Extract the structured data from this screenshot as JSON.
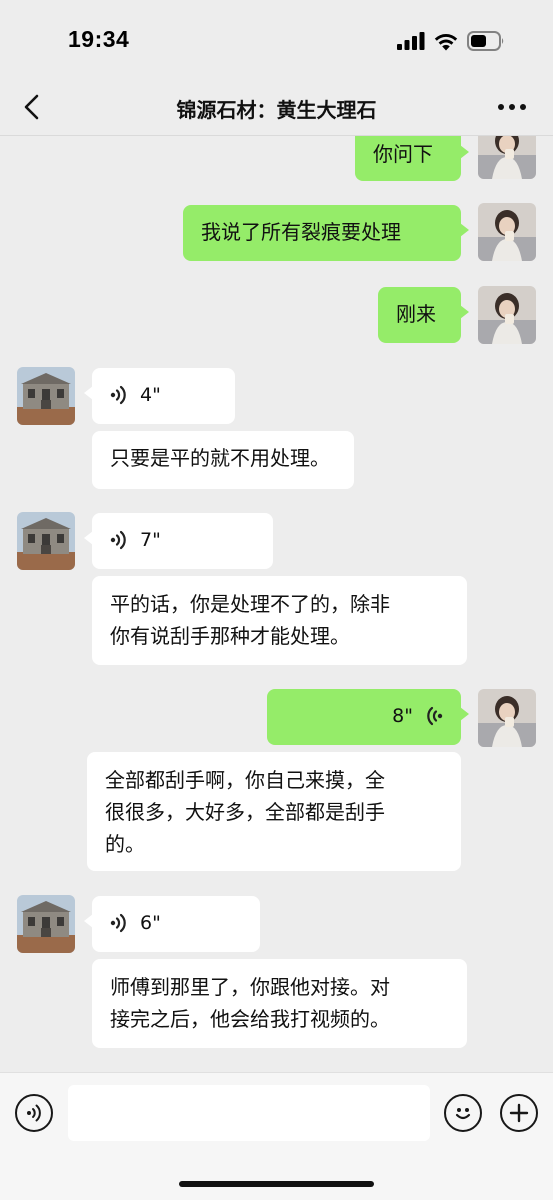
{
  "status_bar": {
    "time": "19:34",
    "icons": [
      "cellular-signal-icon",
      "wifi-icon",
      "battery-icon"
    ]
  },
  "nav": {
    "title": "锦源石材：黄生大理石",
    "back_icon": "chevron-left-icon",
    "more_icon": "more-dots-icon"
  },
  "messages": [
    {
      "sender": "me",
      "type": "text",
      "text": "你问下"
    },
    {
      "sender": "me",
      "type": "text",
      "text": "我说了所有裂痕要处理"
    },
    {
      "sender": "me",
      "type": "text",
      "text": "刚来"
    },
    {
      "sender": "other",
      "type": "voice",
      "duration": "4\""
    },
    {
      "sender": "other",
      "type": "transcript",
      "text": "只要是平的就不用处理。"
    },
    {
      "sender": "other",
      "type": "voice",
      "duration": "7\""
    },
    {
      "sender": "other",
      "type": "transcript",
      "lines": [
        "平的话，你是处理不了的，除非",
        "你有说刮手那种才能处理。"
      ]
    },
    {
      "sender": "me",
      "type": "voice",
      "duration": "8\""
    },
    {
      "sender": "me",
      "type": "transcript",
      "lines": [
        "全部都刮手啊，你自己来摸，全",
        "很很多，大好多，全部都是刮手",
        "的。"
      ]
    },
    {
      "sender": "other",
      "type": "voice",
      "duration": "6\""
    },
    {
      "sender": "other",
      "type": "transcript",
      "lines": [
        "师傅到那里了，你跟他对接。对",
        "接完之后，他会给我打视频的。"
      ]
    }
  ],
  "input_bar": {
    "voice_toggle_icon": "voice-mode-icon",
    "emoji_icon": "emoji-icon",
    "plus_icon": "plus-icon",
    "placeholder": ""
  },
  "colors": {
    "my_bubble": "#95ec69",
    "their_bubble": "#ffffff",
    "background": "#ededed"
  }
}
